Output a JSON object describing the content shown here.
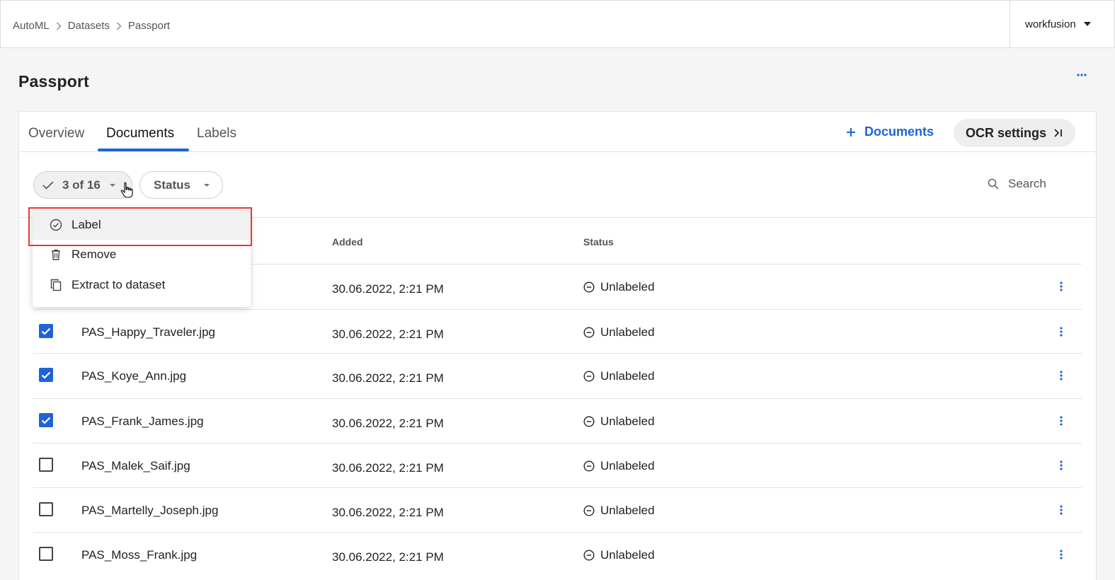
{
  "breadcrumb": [
    "AutoML",
    "Datasets",
    "Passport"
  ],
  "user": {
    "name": "workfusion"
  },
  "page": {
    "title": "Passport"
  },
  "tabs": [
    {
      "label": "Overview",
      "active": false
    },
    {
      "label": "Documents",
      "active": true
    },
    {
      "label": "Labels",
      "active": false
    }
  ],
  "actions": {
    "add_documents": "Documents",
    "ocr_settings": "OCR settings"
  },
  "filters": {
    "selection": "3 of 16",
    "status": "Status",
    "search_placeholder": "Search"
  },
  "menu": {
    "items": [
      "Label",
      "Remove",
      "Extract to dataset"
    ],
    "highlighted": "Label"
  },
  "table": {
    "headers": {
      "added": "Added",
      "status": "Status"
    },
    "rows": [
      {
        "name": "",
        "added": "30.06.2022, 2:21 PM",
        "status": "Unlabeled",
        "checked": false
      },
      {
        "name": "PAS_Happy_Traveler.jpg",
        "added": "30.06.2022, 2:21 PM",
        "status": "Unlabeled",
        "checked": true
      },
      {
        "name": "PAS_Koye_Ann.jpg",
        "added": "30.06.2022, 2:21 PM",
        "status": "Unlabeled",
        "checked": true
      },
      {
        "name": "PAS_Frank_James.jpg",
        "added": "30.06.2022, 2:21 PM",
        "status": "Unlabeled",
        "checked": true
      },
      {
        "name": "PAS_Malek_Saif.jpg",
        "added": "30.06.2022, 2:21 PM",
        "status": "Unlabeled",
        "checked": false
      },
      {
        "name": "PAS_Martelly_Joseph.jpg",
        "added": "30.06.2022, 2:21 PM",
        "status": "Unlabeled",
        "checked": false
      },
      {
        "name": "PAS_Moss_Frank.jpg",
        "added": "30.06.2022, 2:21 PM",
        "status": "Unlabeled",
        "checked": false
      }
    ]
  },
  "colors": {
    "accent": "#1e64d6",
    "highlight_border": "#e53935"
  }
}
